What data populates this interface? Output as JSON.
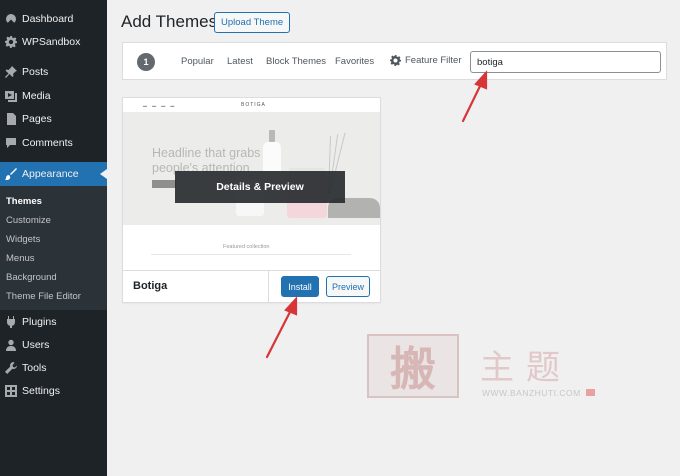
{
  "sidebar": {
    "items": [
      {
        "label": "Dashboard",
        "icon": "dashboard-icon"
      },
      {
        "label": "WPSandbox",
        "icon": "gear-icon"
      },
      {
        "label": "Posts",
        "icon": "pin-icon"
      },
      {
        "label": "Media",
        "icon": "media-icon"
      },
      {
        "label": "Pages",
        "icon": "page-icon"
      },
      {
        "label": "Comments",
        "icon": "comment-icon"
      },
      {
        "label": "Appearance",
        "icon": "brush-icon"
      },
      {
        "label": "Plugins",
        "icon": "plug-icon"
      },
      {
        "label": "Users",
        "icon": "user-icon"
      },
      {
        "label": "Tools",
        "icon": "wrench-icon"
      },
      {
        "label": "Settings",
        "icon": "settings-icon"
      }
    ],
    "submenu": [
      "Themes",
      "Customize",
      "Widgets",
      "Menus",
      "Background",
      "Theme File Editor"
    ],
    "active_color": "#2271b1"
  },
  "header": {
    "title": "Add Themes",
    "upload_label": "Upload Theme"
  },
  "filter": {
    "count": "1",
    "links": [
      "Popular",
      "Latest",
      "Block Themes",
      "Favorites"
    ],
    "feature_filter_label": "Feature Filter",
    "search_value": "botiga"
  },
  "theme": {
    "name": "Botiga",
    "install_label": "Install",
    "preview_label": "Preview",
    "overlay_label": "Details & Preview",
    "screenshot": {
      "logo": "BOTIGA",
      "headline": "Headline that grabs people's attention",
      "featured": "Featured collection"
    }
  },
  "watermark": {
    "logo_char": "搬",
    "text": "主题",
    "url": "WWW.BANZHUTI.COM"
  },
  "colors": {
    "primary": "#2271b1",
    "arrow": "#d63638"
  }
}
